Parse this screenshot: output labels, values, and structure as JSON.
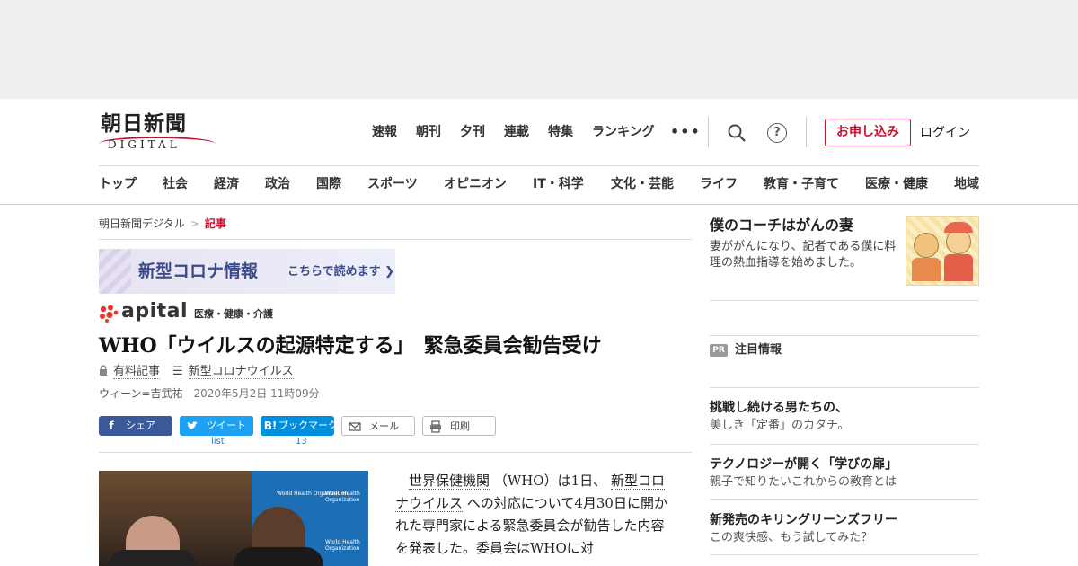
{
  "header": {
    "logo_main": "朝日新聞",
    "logo_sub": "DIGITAL",
    "util_nav": [
      "速報",
      "朝刊",
      "夕刊",
      "連載",
      "特集",
      "ランキング"
    ],
    "more": "•••",
    "help": "?",
    "apply": "お申し込み",
    "login": "ログイン"
  },
  "main_nav": [
    "トップ",
    "社会",
    "経済",
    "政治",
    "国際",
    "スポーツ",
    "オピニオン",
    "IT・科学",
    "文化・芸能",
    "ライフ",
    "教育・子育て",
    "医療・健康",
    "地域"
  ],
  "breadcrumb": {
    "home": "朝日新聞デジタル",
    "sep": ">",
    "current": "記事"
  },
  "banner": {
    "title": "新型コロナ情報",
    "link": "こちらで読めます ❯"
  },
  "apital": {
    "word": "apital",
    "sub": "医療・健康・介護"
  },
  "article": {
    "headline": "WHO「ウイルスの起源特定する」　緊急委員会勧告受け",
    "paid": "有料記事",
    "topic": "新型コロナウイルス",
    "author": "ウィーン=吉武祐",
    "date": "2020年5月2日 11時09分",
    "body_1": "世界保健機関",
    "body_2": "（WHO）は1日、",
    "body_3": "新型コロナウイルス",
    "body_4": "への対応について4月30日に開かれた専門家による緊急委員会が勧告した内容を発表した。委員会はWHOに対",
    "photo_text": "World Health Organization"
  },
  "share": {
    "facebook": "シェア",
    "twitter": "ツイート",
    "twitter_count": "list",
    "hatena": "ブックマーク",
    "hatena_icon": "B!",
    "hatena_count": "13",
    "mail": "メール",
    "print": "印刷"
  },
  "sidebar": {
    "feature_title": "僕のコーチはがんの妻",
    "feature_desc": "妻ががんになり、記者である僕に料理の熱血指導を始めました。",
    "pr_badge": "PR",
    "pr_label": "注目情報",
    "pr_items": [
      {
        "title": "挑戦し続ける男たちの、",
        "desc": "美しき「定番」のカタチ。"
      },
      {
        "title": "テクノロジーが開く「学びの扉」",
        "desc": "親子で知りたいこれからの教育とは"
      },
      {
        "title": "新発売のキリングリーンズフリー",
        "desc": "この爽快感、もう試してみた？"
      }
    ]
  },
  "colors": {
    "brand_red": "#c8102e",
    "facebook": "#3b5998",
    "twitter": "#1da1f2",
    "hatena": "#008fde"
  }
}
